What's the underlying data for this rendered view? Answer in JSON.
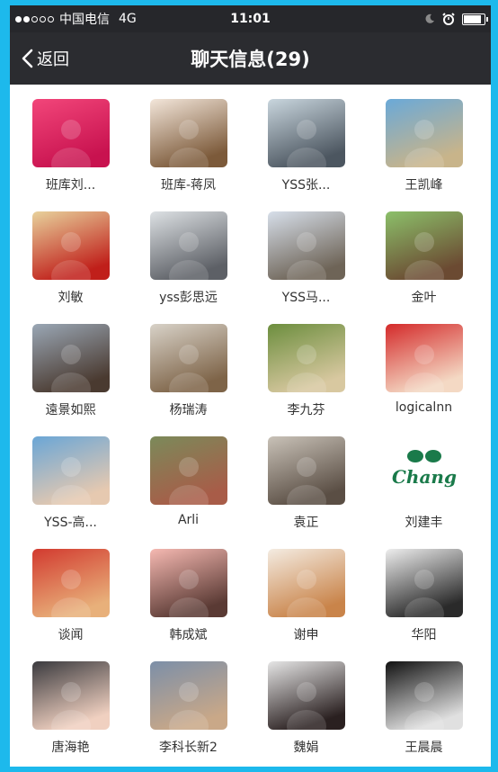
{
  "status_bar": {
    "carrier": "中国电信",
    "network": "4G",
    "time": "11:01",
    "moon_icon": "moon-icon",
    "alarm_icon": "alarm-icon",
    "battery_icon": "battery-icon"
  },
  "nav": {
    "back_label": "返回",
    "title": "聊天信息(29)"
  },
  "members": [
    {
      "name": "班库刘...",
      "colors": [
        "#f2467a",
        "#c8124f"
      ]
    },
    {
      "name": "班库-蒋凤",
      "colors": [
        "#f3e6da",
        "#7c5a3a"
      ]
    },
    {
      "name": "YSS张...",
      "colors": [
        "#c9d6de",
        "#4c5660"
      ]
    },
    {
      "name": "王凯峰",
      "colors": [
        "#6aa9d8",
        "#c8b48a"
      ]
    },
    {
      "name": "刘敏",
      "colors": [
        "#e8d29c",
        "#c01f1a"
      ]
    },
    {
      "name": "yss彭思远",
      "colors": [
        "#dde1e4",
        "#5d6066"
      ]
    },
    {
      "name": "YSS马...",
      "colors": [
        "#d7dfea",
        "#6e6457"
      ]
    },
    {
      "name": "金叶",
      "colors": [
        "#8cc06a",
        "#6b4a32"
      ]
    },
    {
      "name": "遠景如熙",
      "colors": [
        "#9aa7b5",
        "#4a3a30"
      ]
    },
    {
      "name": "杨瑞涛",
      "colors": [
        "#d8d2c8",
        "#7e6448"
      ]
    },
    {
      "name": "李九芬",
      "colors": [
        "#6c8e3e",
        "#d8c8a0"
      ]
    },
    {
      "name": "logicalnn",
      "colors": [
        "#d42a2a",
        "#f4d9c4"
      ]
    },
    {
      "name": "YSS-高...",
      "colors": [
        "#6aa6d6",
        "#e6c9b0"
      ]
    },
    {
      "name": "Arli",
      "colors": [
        "#7b8a5a",
        "#a85c48"
      ]
    },
    {
      "name": "袁正",
      "colors": [
        "#c9c2b8",
        "#5a4e44"
      ]
    },
    {
      "name": "刘建丰",
      "colors": [
        "#ffffff",
        "#1a7a4a"
      ],
      "logo_text": "Chang"
    },
    {
      "name": "谈闻",
      "colors": [
        "#d23a2f",
        "#e8b07a"
      ]
    },
    {
      "name": "韩成斌",
      "colors": [
        "#f6b9b2",
        "#5a3a34"
      ]
    },
    {
      "name": "谢申",
      "colors": [
        "#f4ece2",
        "#c9844a"
      ]
    },
    {
      "name": "华阳",
      "colors": [
        "#eeeeee",
        "#2a2a2a"
      ]
    },
    {
      "name": "唐海艳",
      "colors": [
        "#3a3a3e",
        "#f0d0c0"
      ]
    },
    {
      "name": "李科长新2",
      "colors": [
        "#7c8fa8",
        "#c9a888"
      ]
    },
    {
      "name": "魏娟",
      "colors": [
        "#e6e6e6",
        "#2a2020"
      ]
    },
    {
      "name": "王晨晨",
      "colors": [
        "#111111",
        "#e0e0e0"
      ]
    }
  ]
}
